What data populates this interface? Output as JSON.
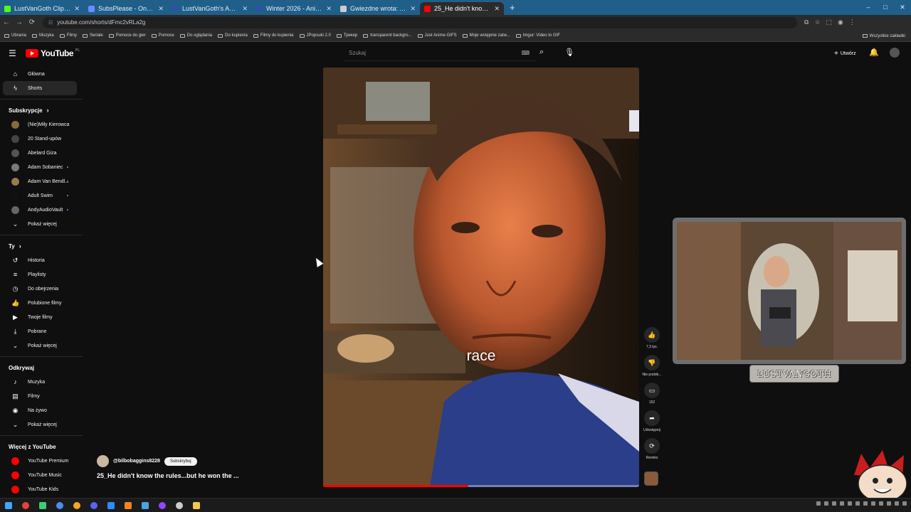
{
  "browser": {
    "tabs": [
      {
        "title": "LustVanGoth Clips - Watch Live",
        "color": "#53fc18",
        "active": false
      },
      {
        "title": "SubsPlease - One stop shop fo",
        "color": "#6b8cff",
        "active": false
      },
      {
        "title": "LustVanGoth's Anime List - My",
        "color": "#2e51a2",
        "active": false
      },
      {
        "title": "Winter 2026 - Anime - MyAnim",
        "color": "#2e51a2",
        "active": false
      },
      {
        "title": "Gwiezdne wrota: Atlantyda / St",
        "color": "#cccccc",
        "active": false
      },
      {
        "title": "25_He didn't know the rules",
        "color": "#ff0000",
        "active": true
      }
    ],
    "new_tab": "+",
    "window_controls": [
      "–",
      "□",
      "✕"
    ],
    "url": "youtube.com/shorts/dFmc2vRLa2g",
    "bookmarks": [
      "Ubrania",
      "Muzyka",
      "Filmy",
      "Seriale",
      "Pomoce do gier",
      "Pomoce",
      "Do oglądania",
      "Do kupienia",
      "Filmy do kupienia",
      "JPopsuki 2.0",
      "Трекер",
      "transparent backgro...",
      "Just Anime GIFS",
      "Moje wstępnie zatw...",
      "Imgur: Video to GIF"
    ],
    "bookmarks_right": "Wszystkie zakładki"
  },
  "youtube": {
    "logo_text": "YouTube",
    "logo_country": "PL",
    "search_placeholder": "Szukaj",
    "create_label": "Utwórz",
    "sidebar": {
      "main": [
        {
          "label": "Główna",
          "icon": "⌂",
          "active": false
        },
        {
          "label": "Shorts",
          "icon": "ϟ",
          "active": true
        }
      ],
      "subscriptions_title": "Subskrypcje",
      "subscriptions": [
        {
          "label": "(Nie)Miły Kierowca",
          "color": "#8a6a3a",
          "dot": false
        },
        {
          "label": "20 Stand-upów",
          "color": "#444444",
          "dot": false
        },
        {
          "label": "Abelard Giza",
          "color": "#555555",
          "dot": false
        },
        {
          "label": "Adam Sobaniec",
          "color": "#7a7a7a",
          "dot": true
        },
        {
          "label": "Adam Van Bendl...",
          "color": "#9a7a4a",
          "dot": true
        },
        {
          "label": "Adult Swim",
          "color": "#111111",
          "dot": true
        },
        {
          "label": "AndyAudioVault",
          "color": "#666666",
          "dot": true
        }
      ],
      "show_more": "Pokaż więcej",
      "you_title": "Ty",
      "you": [
        {
          "label": "Historia",
          "icon": "↺"
        },
        {
          "label": "Playlisty",
          "icon": "≡"
        },
        {
          "label": "Do obejrzenia",
          "icon": "◷"
        },
        {
          "label": "Polubione filmy",
          "icon": "👍"
        },
        {
          "label": "Twoje filmy",
          "icon": "▶"
        },
        {
          "label": "Pobrane",
          "icon": "⤓"
        },
        {
          "label": "Pokaż więcej",
          "icon": "⌄"
        }
      ],
      "explore_title": "Odkrywaj",
      "explore": [
        {
          "label": "Muzyka",
          "icon": "♪"
        },
        {
          "label": "Filmy",
          "icon": "▤"
        },
        {
          "label": "Na żywo",
          "icon": "◉"
        },
        {
          "label": "Pokaż więcej",
          "icon": "⌄"
        }
      ],
      "more_title": "Więcej z YouTube",
      "more": [
        {
          "label": "YouTube Premium",
          "color": "#ff0000"
        },
        {
          "label": "YouTube Music",
          "color": "#ff0000"
        },
        {
          "label": "YouTube Kids",
          "color": "#ff0000"
        }
      ]
    },
    "short": {
      "caption": "race",
      "progress": 0.46,
      "channel": "@bilbobaggins8228",
      "subscribe_label": "Subskrybuj",
      "title": "25_He didn't know the rules...but he won the ..."
    },
    "actions": [
      {
        "name": "like",
        "icon": "👍",
        "label": "7,3 tys."
      },
      {
        "name": "dislike",
        "icon": "👎",
        "label": "Nie podob..."
      },
      {
        "name": "comments",
        "icon": "▭",
        "label": "152"
      },
      {
        "name": "share",
        "icon": "➦",
        "label": "Udostępnij"
      },
      {
        "name": "remix",
        "icon": "⟳",
        "label": "Remiks"
      }
    ]
  },
  "overlay": {
    "label": "LUSTVANGOTH"
  }
}
